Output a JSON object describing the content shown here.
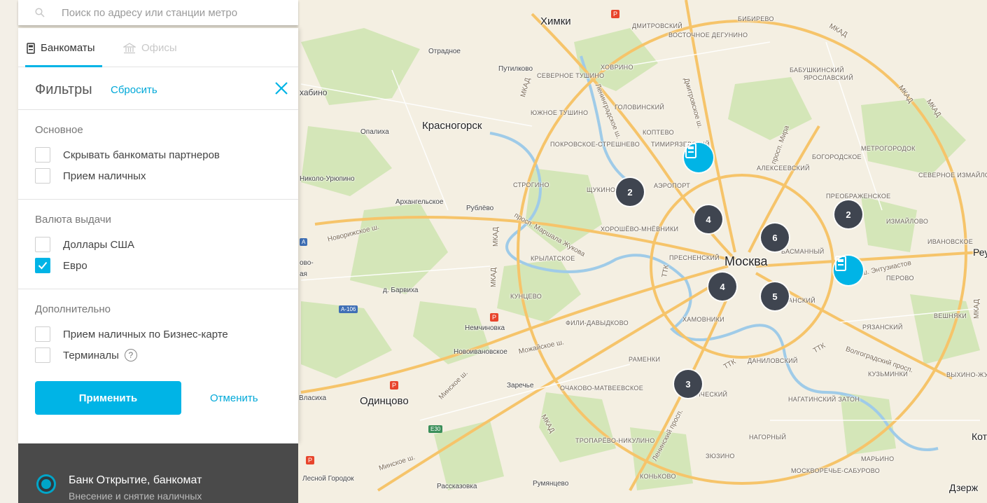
{
  "search": {
    "placeholder": "Поиск по адресу или станции метро"
  },
  "tabs": [
    {
      "label": "Банкоматы",
      "active": true
    },
    {
      "label": "Офисы",
      "active": false
    }
  ],
  "filters": {
    "title": "Фильтры",
    "reset_label": "Сбросить",
    "sections": [
      {
        "title": "Основное",
        "items": [
          {
            "label": "Скрывать банкоматы партнеров",
            "checked": false
          },
          {
            "label": "Прием наличных",
            "checked": false
          }
        ]
      },
      {
        "title": "Валюта выдачи",
        "items": [
          {
            "label": "Доллары США",
            "checked": false
          },
          {
            "label": "Евро",
            "checked": true
          }
        ]
      },
      {
        "title": "Дополнительно",
        "items": [
          {
            "label": "Прием наличных по Бизнес-карте",
            "checked": false
          },
          {
            "label": "Терминалы",
            "checked": false
          }
        ]
      }
    ],
    "help_glyph": "?",
    "apply_label": "Применить",
    "cancel_label": "Отменить"
  },
  "result_card": {
    "title": "Банк Открытие, банкомат",
    "subtitle": "Внесение и снятие наличных"
  },
  "colors": {
    "accent": "#00b4e6",
    "cluster": "#3f4550",
    "panel_dark": "#4a4a4a"
  },
  "map": {
    "clusters": [
      "2",
      "4",
      "6",
      "2",
      "4",
      "5",
      "3"
    ],
    "labels": {
      "khimki": "Химки",
      "krasnogorsk": "Красногорск",
      "moskva": "Москва",
      "odintsovo": "Одинцово",
      "mkad": "МКАД",
      "ttk": "ТТК",
      "bibirevo": "БИБИРЕВО",
      "dmitrovsky": "ДМИТРОВСКИЙ",
      "vostochnoe_degunino": "ВОСТОЧНОЕ ДЕГУНИНО",
      "khovrino": "ХОВРИНО",
      "severnoe_tushino": "СЕВЕРНОЕ ТУШИНО",
      "yuzhnoe_tushino": "ЮЖНОЕ ТУШИНО",
      "golovinsky": "ГОЛОВИНСКИЙ",
      "koptevo": "КОПТЕВО",
      "timiryazevsky": "ТИМИРЯЗЕВСКИЙ",
      "pokrovskoe": "ПОКРОВСКОЕ-СТРЕШНЕВО",
      "shchukino": "ЩУКИНО",
      "aeroport": "АЭРОПОРТ",
      "strogino": "СТРОГИНО",
      "khoroshevo": "ХОРОШЁВО-МНЁВНИКИ",
      "presnensky": "ПРЕСНЕНСКИЙ",
      "krylatskoe": "КРЫЛАТСКОЕ",
      "kuntsevo": "КУНЦЕВО",
      "fili": "ФИЛИ-ДАВЫДКОВО",
      "khamovniki": "ХАМОВНИКИ",
      "ramenki": "РАМЕНКИ",
      "ochakovo": "ОЧАКОВО-МАТВЕЕВСКОЕ",
      "troparevo": "ТРОПАРЁВО-НИКУЛИНО",
      "konkovo": "КОНЬКОВО",
      "zyuzino": "ЗЮЗИНО",
      "nagorny": "НАГОРНЫЙ",
      "danilovsky": "ДАНИЛОВСКИЙ",
      "nagatinsky": "НАГАТИНСКИЙ ЗАТОН",
      "moskvorechye": "МОСКВОРЕЧЬЕ-САБУРОВО",
      "marino": "МАРЬИНО",
      "kuzminki": "КУЗЬМИНКИ",
      "ryazansky": "РЯЗАНСКИЙ",
      "veshnyaki": "ВЕШНЯКИ",
      "perovo": "ПЕРОВО",
      "izmaylovo": "ИЗМАЙЛОВО",
      "ivanovskoe": "ИВАНОВСКОЕ",
      "preobrazhenskoe": "ПРЕОБРАЖЕНСКОЕ",
      "severnoe_izmaylovo": "СЕВЕРНОЕ ИЗМАЙЛОВО",
      "metrogorodok": "МЕТРОГОРОДОК",
      "bogorodskoe": "БОГОРОДСКОЕ",
      "alekseevsky": "АЛЕКСЕЕВСКИЙ",
      "babushkinsky": "БАБУШКИНСКИЙ",
      "yaroslavsky": "ЯРОСЛАВСКИЙ",
      "basmanny": "БАСМАННЫЙ",
      "tagansky": "АНСКИЙ",
      "yuzhnoport": "ИЧЕСКИЙ",
      "vykhino": "ВЫХИНО-ЖУЛЕБИНО",
      "otradnoe": "Отрадное",
      "putilkovo": "Путилково",
      "opaliha": "Опалиха",
      "nikolo": "Николо-Урюпино",
      "arkhangelskoe": "Архангельское",
      "rublevo": "Рублёво",
      "barvikha": "д. Барвиха",
      "nemchinovka": "Немчиновка",
      "novoivanovskoe": "Новоивановское",
      "zarechye": "Заречье",
      "vlasikha": "Власиха",
      "lesnoy": "Лесной Городок",
      "rasskazovka": "Рассказовка",
      "rumyantsevo": "Румянцево",
      "khabino": "хабино",
      "reu": "Реу",
      "kot": "Кот",
      "dzerzh": "Дзерж",
      "novorizhskoe": "Новорижское ш.",
      "mozhayskoe": "Можайское ш.",
      "minskoe": "Минское ш.",
      "minskoe2": "Минское ш.",
      "leninsky": "Ленинский просп.",
      "marshala": "просп. Маршала Жукова",
      "leningradskoe": "Ленинградское ш.",
      "dmitrovskoe": "Дмитровское ш.",
      "prosp_mira": "просп. Мира",
      "entuziastov": "ш. Энтузиастов",
      "volgogradsky": "Волгоградский просп.",
      "a106": "А-106",
      "e30": "Е30",
      "bovo": "ово-",
      "kaya": "ая",
      "rail": "Р",
      "a_letter": "А"
    }
  }
}
